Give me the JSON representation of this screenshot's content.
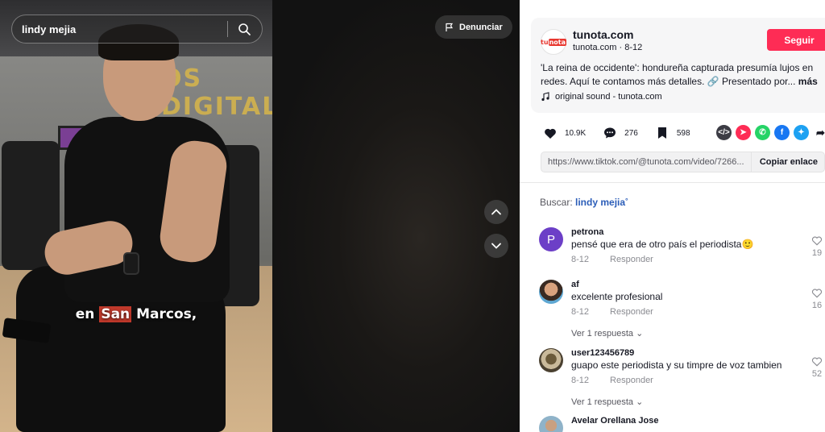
{
  "video": {
    "search_value": "lindy mejia",
    "report_label": "Denunciar",
    "caption_prefix": "en ",
    "caption_highlight": "San",
    "caption_suffix": " Marcos,"
  },
  "author": {
    "logo_text_a": "tu",
    "logo_text_b": "nota",
    "name": "tunota.com",
    "subtitle": "tunota.com · 8-12",
    "follow_label": "Seguir",
    "description": "'La reina de occidente': hondureña capturada presumía lujos en redes. Aquí te contamos más detalles. 🔗 Presentado por...",
    "more_label": "más",
    "sound": "original sound - tunota.com"
  },
  "stats": {
    "likes": "10.9K",
    "comments": "276",
    "saves": "598"
  },
  "share": {
    "link": "https://www.tiktok.com/@tunota.com/video/7266...",
    "copy_label": "Copiar enlace"
  },
  "search_hint": {
    "label": "Buscar: ",
    "term": "lindy mejia"
  },
  "comments": [
    {
      "user": "petrona",
      "text": "pensé que era de otro país el periodista🙂",
      "date": "8-12",
      "reply": "Responder",
      "likes": "19",
      "avatar_letter": "P",
      "avatar_color": "#6c3fc7"
    },
    {
      "user": "af",
      "text": "excelente profesional",
      "date": "8-12",
      "reply": "Responder",
      "likes": "16",
      "replies": "Ver 1 respuesta"
    },
    {
      "user": "user123456789",
      "text": "guapo este periodista y su timpre de voz tambien",
      "date": "8-12",
      "reply": "Responder",
      "likes": "52",
      "replies": "Ver 1 respuesta"
    },
    {
      "user": "Avelar Orellana Jose"
    }
  ],
  "colors": {
    "follow": "#fe2c55",
    "search_term": "#2b5db8"
  }
}
